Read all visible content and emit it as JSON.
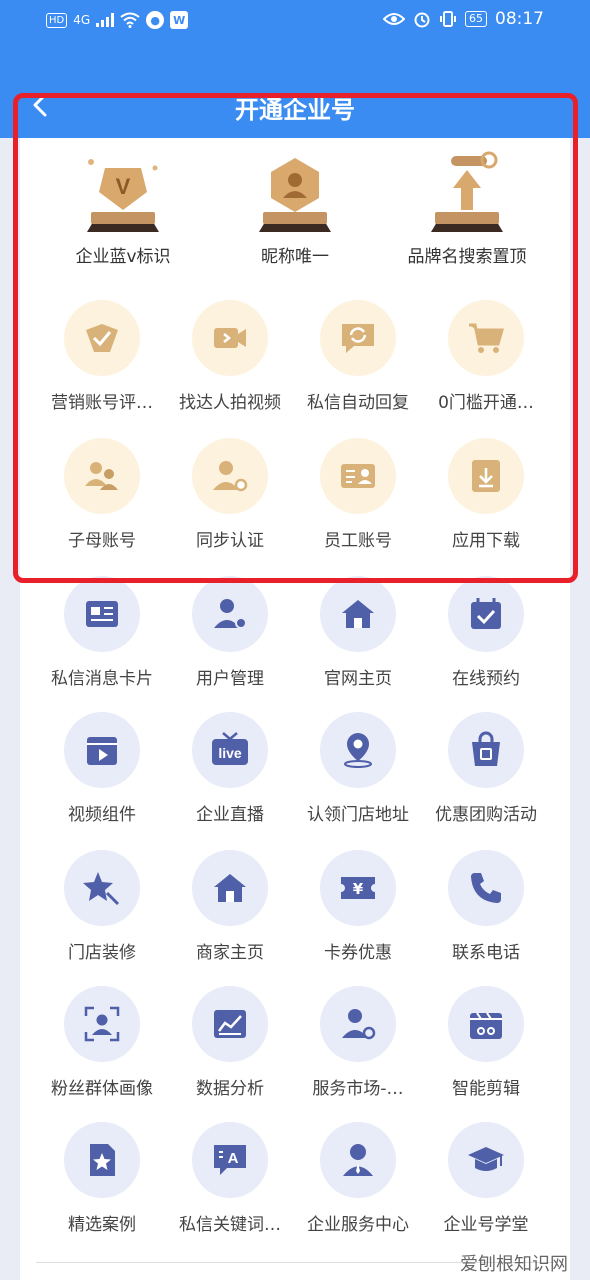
{
  "status": {
    "hd": "HD",
    "net": "4G",
    "battery": "65",
    "time": "08:17"
  },
  "header": {
    "title": "开通企业号"
  },
  "premium": [
    {
      "label": "企业蓝v标识",
      "icon": "v-badge-trophy-icon"
    },
    {
      "label": "昵称唯一",
      "icon": "user-badge-trophy-icon"
    },
    {
      "label": "品牌名搜索置顶",
      "icon": "search-top-trophy-icon"
    }
  ],
  "gold_items": [
    {
      "label": "营销账号评…",
      "icon": "verify-check-icon"
    },
    {
      "label": "找达人拍视频",
      "icon": "video-camera-icon"
    },
    {
      "label": "私信自动回复",
      "icon": "auto-reply-icon"
    },
    {
      "label": "0门槛开通…",
      "icon": "cart-icon"
    },
    {
      "label": "子母账号",
      "icon": "linked-accounts-icon"
    },
    {
      "label": "同步认证",
      "icon": "sync-user-icon"
    },
    {
      "label": "员工账号",
      "icon": "employee-card-icon"
    },
    {
      "label": "应用下载",
      "icon": "download-icon"
    }
  ],
  "blue_items": [
    {
      "label": "私信消息卡片",
      "icon": "message-card-icon"
    },
    {
      "label": "用户管理",
      "icon": "user-manage-icon"
    },
    {
      "label": "官网主页",
      "icon": "home-icon"
    },
    {
      "label": "在线预约",
      "icon": "calendar-check-icon"
    },
    {
      "label": "视频组件",
      "icon": "video-clapper-icon"
    },
    {
      "label": "企业直播",
      "icon": "live-tv-icon"
    },
    {
      "label": "认领门店地址",
      "icon": "location-pin-icon"
    },
    {
      "label": "优惠团购活动",
      "icon": "shopping-bag-icon"
    },
    {
      "label": "门店装修",
      "icon": "decor-star-icon"
    },
    {
      "label": "商家主页",
      "icon": "store-home-icon"
    },
    {
      "label": "卡券优惠",
      "icon": "coupon-icon"
    },
    {
      "label": "联系电话",
      "icon": "phone-icon"
    },
    {
      "label": "粉丝群体画像",
      "icon": "fan-portrait-icon"
    },
    {
      "label": "数据分析",
      "icon": "data-chart-icon"
    },
    {
      "label": "服务市场-…",
      "icon": "service-market-icon"
    },
    {
      "label": "智能剪辑",
      "icon": "smart-edit-icon"
    },
    {
      "label": "精选案例",
      "icon": "case-star-icon"
    },
    {
      "label": "私信关键词…",
      "icon": "keyword-reply-icon"
    },
    {
      "label": "企业服务中心",
      "icon": "service-center-icon"
    },
    {
      "label": "企业号学堂",
      "icon": "graduation-cap-icon"
    }
  ],
  "watermark": "爱刨根知识网",
  "colors": {
    "header": "#3b8cf2",
    "gold": "#c9a266",
    "blue": "#4f5fa8",
    "highlight": "#e8202a"
  }
}
